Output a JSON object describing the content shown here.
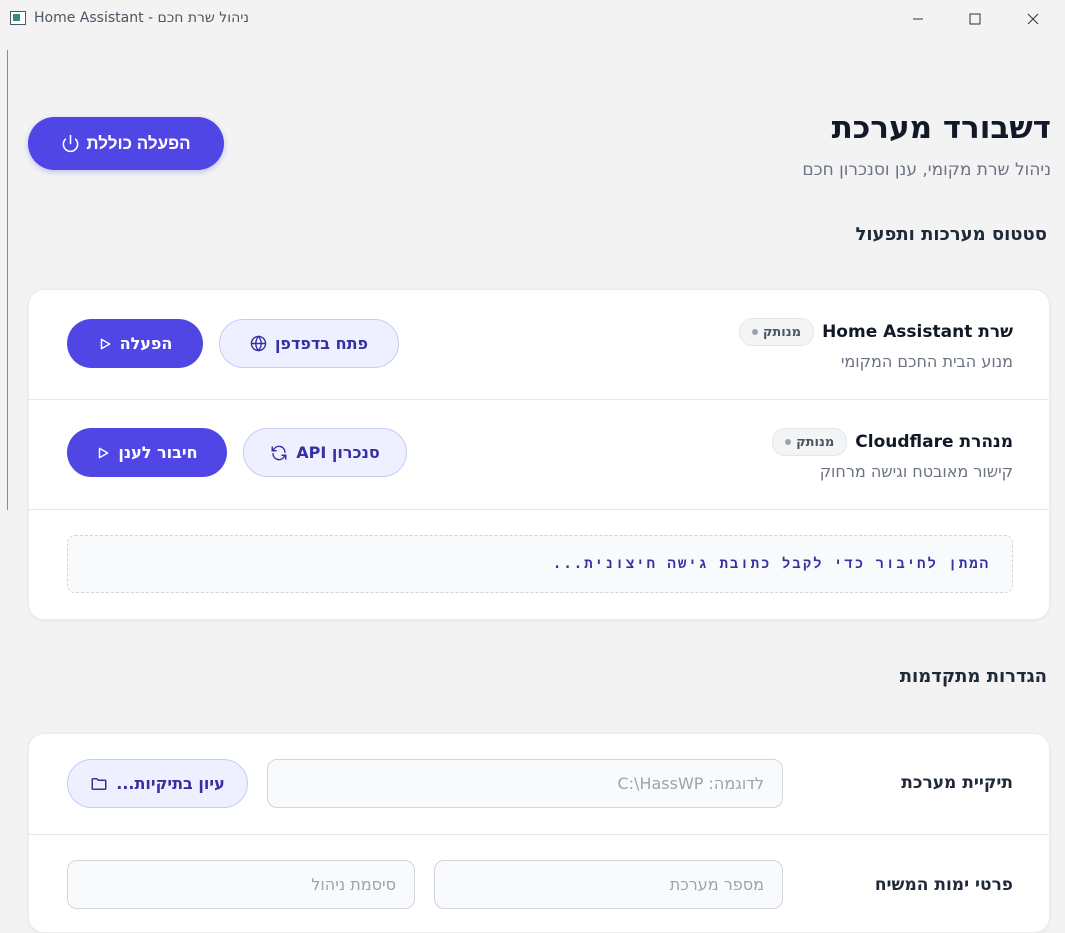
{
  "window": {
    "title": "ניהול שרת חכם - Home Assistant"
  },
  "header": {
    "title": "דשבורד מערכת",
    "subtitle": "ניהול שרת מקומי, ענן וסנכרון חכם",
    "global_start_label": "הפעלה כוללת"
  },
  "status_section": {
    "heading": "סטטוס מערכות ותפעול",
    "services": [
      {
        "title": "שרת Home Assistant",
        "status": "מנותק",
        "description": "מנוע הבית החכם המקומי",
        "secondary_label": "פתח בדפדפן",
        "primary_label": "הפעלה"
      },
      {
        "title": "מנהרת Cloudflare",
        "status": "מנותק",
        "description": "קישור מאובטח וגישה מרחוק",
        "secondary_label": "סנכרון API",
        "primary_label": "חיבור לענן"
      }
    ],
    "info_message": "המתן לחיבור כדי לקבל כתובת גישה חיצונית..."
  },
  "advanced_section": {
    "heading": "הגדרות מתקדמות",
    "folder": {
      "label": "תיקיית מערכת",
      "placeholder": "לדוגמה: C:\\HassWP",
      "browse_label": "עיון בתיקיות..."
    },
    "credentials": {
      "label": "פרטי ימות המשיח",
      "system_number_placeholder": "מספר מערכת",
      "admin_password_placeholder": "סיסמת ניהול"
    }
  },
  "colors": {
    "accent": "#4f46e5",
    "accent_light": "#eef0ff",
    "status_gray": "#9ca3af"
  }
}
